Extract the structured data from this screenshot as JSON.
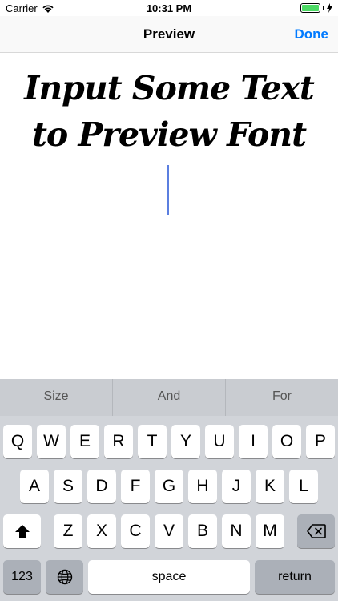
{
  "status": {
    "carrier": "Carrier",
    "time": "10:31 PM"
  },
  "nav": {
    "title": "Preview",
    "done": "Done"
  },
  "preview": {
    "text": "Input Some Text to Preview Font"
  },
  "keyboard": {
    "suggestions": [
      "Size",
      "And",
      "For"
    ],
    "row1": [
      "Q",
      "W",
      "E",
      "R",
      "T",
      "Y",
      "U",
      "I",
      "O",
      "P"
    ],
    "row2": [
      "A",
      "S",
      "D",
      "F",
      "G",
      "H",
      "J",
      "K",
      "L"
    ],
    "row3": [
      "Z",
      "X",
      "C",
      "V",
      "B",
      "N",
      "M"
    ],
    "numbers_label": "123",
    "space_label": "space",
    "return_label": "return"
  },
  "colors": {
    "accent": "#007aff",
    "battery": "#4cd964",
    "cursor": "#5b7fe0"
  }
}
